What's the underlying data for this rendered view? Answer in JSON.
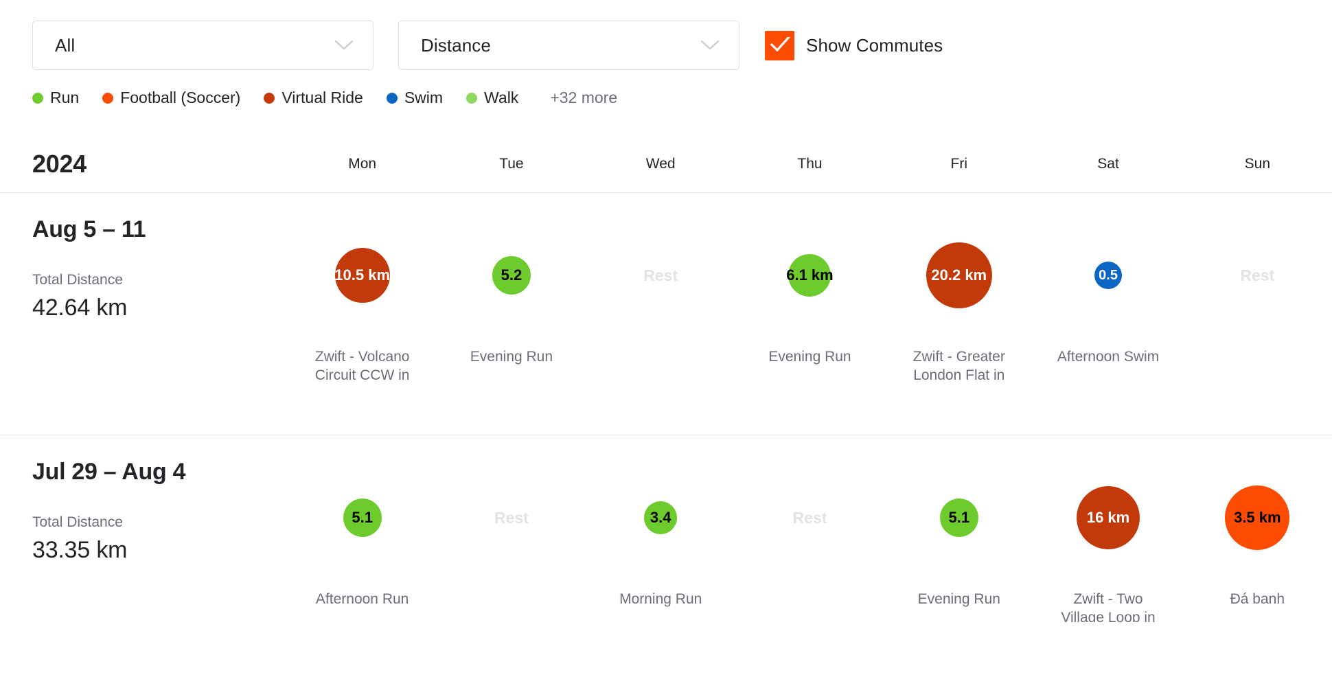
{
  "filters": {
    "sport_select": {
      "value": "All",
      "icon": "chevron-down-icon"
    },
    "metric_select": {
      "value": "Distance",
      "icon": "chevron-down-icon"
    },
    "show_commutes": {
      "label": "Show Commutes",
      "checked": true,
      "color": "#fc4c02"
    }
  },
  "legend": {
    "items": [
      {
        "label": "Run",
        "color": "#6ECB2E"
      },
      {
        "label": "Football (Soccer)",
        "color": "#FC4C02"
      },
      {
        "label": "Virtual Ride",
        "color": "#C23A09"
      },
      {
        "label": "Swim",
        "color": "#0B65C2"
      },
      {
        "label": "Walk",
        "color": "#8FD861"
      }
    ],
    "more": "+32 more"
  },
  "calendar": {
    "year": "2024",
    "day_headers": [
      "Mon",
      "Tue",
      "Wed",
      "Thu",
      "Fri",
      "Sat",
      "Sun"
    ],
    "rest_label": "Rest",
    "total_label": "Total Distance",
    "weeks": [
      {
        "title": "Aug 5 – 11",
        "total_label": "Total Distance",
        "total_value": "42.64 km",
        "days": [
          {
            "rest": false,
            "value": "10.5 km",
            "activity": "Zwift - Volcano Circuit CCW in Watopia",
            "color": "#C23A09",
            "text_color": "#ffffff",
            "size": 80,
            "font_size": 22
          },
          {
            "rest": false,
            "value": "5.2",
            "activity": "Evening Run",
            "color": "#6ECB2E",
            "text_color": "#000000",
            "size": 56,
            "font_size": 22
          },
          {
            "rest": true,
            "value": "Rest",
            "activity": "",
            "color": "",
            "text_color": "",
            "size": 0,
            "font_size": 0
          },
          {
            "rest": false,
            "value": "6.1 km",
            "activity": "Evening Run",
            "color": "#6ECB2E",
            "text_color": "#000000",
            "size": 62,
            "font_size": 22
          },
          {
            "rest": false,
            "value": "20.2 km",
            "activity": "Zwift - Greater London Flat in London",
            "color": "#C23A09",
            "text_color": "#ffffff",
            "size": 96,
            "font_size": 22
          },
          {
            "rest": false,
            "value": "0.5",
            "activity": "Afternoon Swim",
            "color": "#0B65C2",
            "text_color": "#ffffff",
            "size": 40,
            "font_size": 20
          },
          {
            "rest": true,
            "value": "Rest",
            "activity": "",
            "color": "",
            "text_color": "",
            "size": 0,
            "font_size": 0
          }
        ]
      },
      {
        "title": "Jul 29 – Aug 4",
        "total_label": "Total Distance",
        "total_value": "33.35 km",
        "days": [
          {
            "rest": false,
            "value": "5.1",
            "activity": "Afternoon Run",
            "color": "#6ECB2E",
            "text_color": "#000000",
            "size": 56,
            "font_size": 22
          },
          {
            "rest": true,
            "value": "Rest",
            "activity": "",
            "color": "",
            "text_color": "",
            "size": 0,
            "font_size": 0
          },
          {
            "rest": false,
            "value": "3.4",
            "activity": "Morning Run",
            "color": "#6ECB2E",
            "text_color": "#000000",
            "size": 48,
            "font_size": 22
          },
          {
            "rest": true,
            "value": "Rest",
            "activity": "",
            "color": "",
            "text_color": "",
            "size": 0,
            "font_size": 0
          },
          {
            "rest": false,
            "value": "5.1",
            "activity": "Evening Run",
            "color": "#6ECB2E",
            "text_color": "#000000",
            "size": 56,
            "font_size": 22
          },
          {
            "rest": false,
            "value": "16 km",
            "activity": "Zwift - Two Village Loop in Makuri Islands",
            "color": "#C23A09",
            "text_color": "#ffffff",
            "size": 92,
            "font_size": 22
          },
          {
            "rest": false,
            "value": "3.5 km",
            "activity": "Đá banh",
            "color": "#FC4C02",
            "text_color": "#000000",
            "size": 94,
            "font_size": 22
          }
        ]
      }
    ]
  }
}
